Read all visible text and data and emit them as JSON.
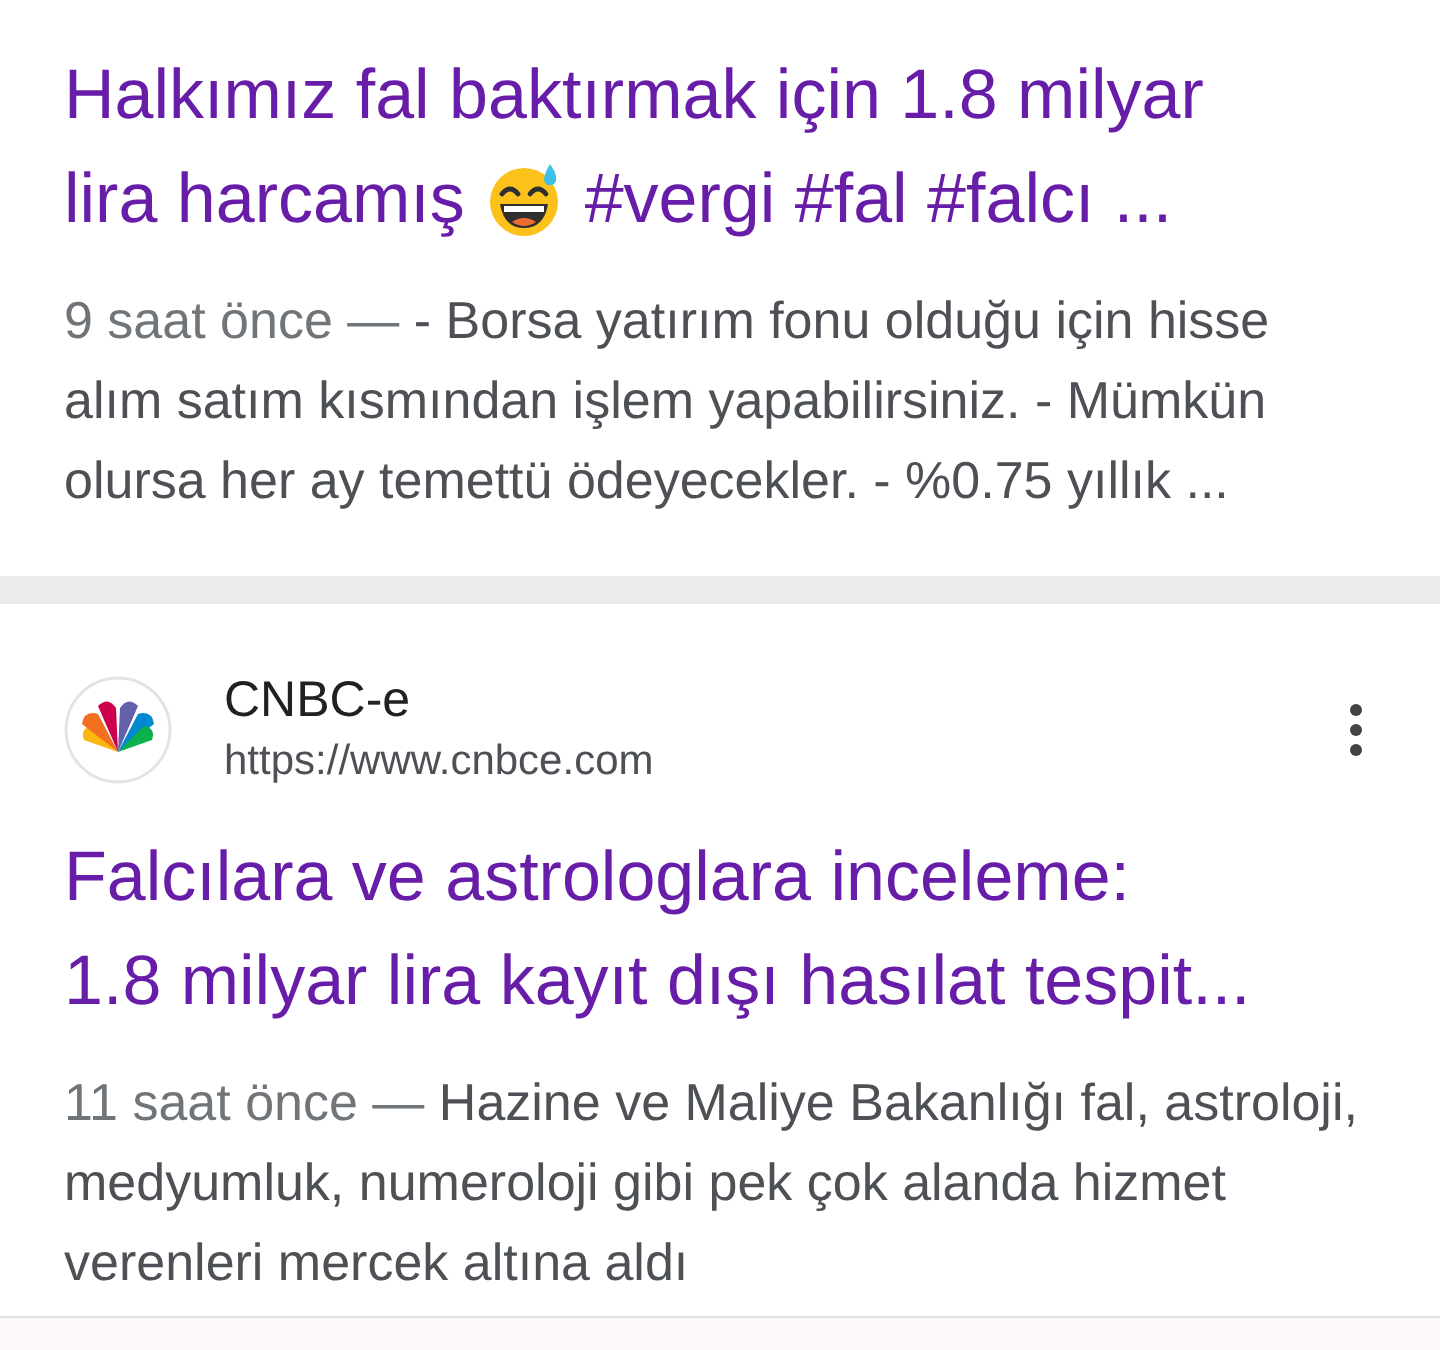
{
  "results": [
    {
      "title_lines": [
        [
          {
            "kind": "text",
            "text": "Halkımız fal baktırmak için 1.8 milyar"
          }
        ],
        [
          {
            "kind": "text",
            "text": "lira harcamış"
          },
          {
            "kind": "emoji"
          },
          {
            "kind": "text",
            "text": "#vergi #fal #falcı ..."
          }
        ]
      ],
      "date": "9 saat önce —",
      "snippet": "- Borsa yatırım fonu olduğu için hisse alım satım kısmından işlem yapabilirsiniz. - Mümkün olursa her ay temettü ödeyecekler. - %0.75 yıllık ..."
    },
    {
      "source": "CNBC-e",
      "url": "https://www.cnbce.com",
      "title_lines": [
        [
          {
            "kind": "text",
            "text": "Falcılara ve astrologlara inceleme:"
          }
        ],
        [
          {
            "kind": "text",
            "text": "1.8 milyar lira kayıt dışı hasılat tespit..."
          }
        ]
      ],
      "date": "11 saat önce —",
      "snippet": "Hazine ve Maliye Bakanlığı fal, astroloji, medyumluk, numeroloji gibi pek çok alanda hizmet verenleri mercek altına aldı"
    }
  ]
}
